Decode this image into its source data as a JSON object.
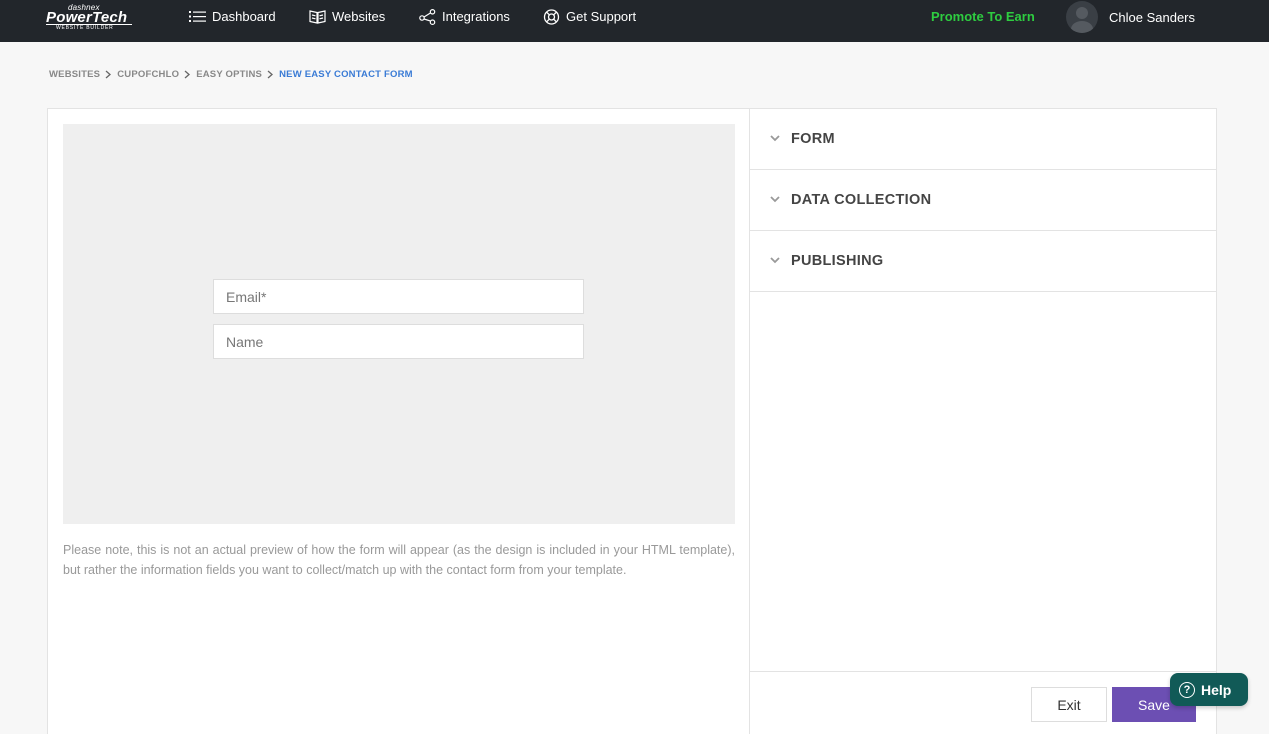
{
  "header": {
    "logo": {
      "small": "dashnex",
      "brand": "PowerTech",
      "tagline": "WEBSITE BUILDER"
    },
    "nav": [
      {
        "label": "Dashboard",
        "icon": "list-icon"
      },
      {
        "label": "Websites",
        "icon": "book-icon"
      },
      {
        "label": "Integrations",
        "icon": "share-icon"
      },
      {
        "label": "Get Support",
        "icon": "lifebuoy-icon"
      }
    ],
    "promote": "Promote To Earn",
    "user": {
      "name": "Chloe Sanders",
      "icon": "avatar"
    }
  },
  "breadcrumb": [
    "WEBSITES",
    "CUPOFCHLO",
    "EASY OPTINS",
    "NEW EASY CONTACT FORM"
  ],
  "preview": {
    "email_placeholder": "Email*",
    "name_placeholder": "Name",
    "note": "Please note, this is not an actual preview of how the form will appear (as the design is included in your HTML template), but rather the information fields you want to collect/match up with the contact form from your template."
  },
  "sections": [
    {
      "label": "FORM",
      "icon": "chevron-down-icon"
    },
    {
      "label": "DATA COLLECTION",
      "icon": "chevron-down-icon"
    },
    {
      "label": "PUBLISHING",
      "icon": "chevron-down-icon"
    }
  ],
  "actions": {
    "exit": "Exit",
    "save": "Save"
  },
  "help": {
    "label": "Help",
    "icon": "question-icon"
  },
  "colors": {
    "topbar": "#22262b",
    "promote": "#2ecc40",
    "breadcrumb_active": "#3a7bd5",
    "save": "#6c4fb3",
    "help": "#115a57"
  }
}
